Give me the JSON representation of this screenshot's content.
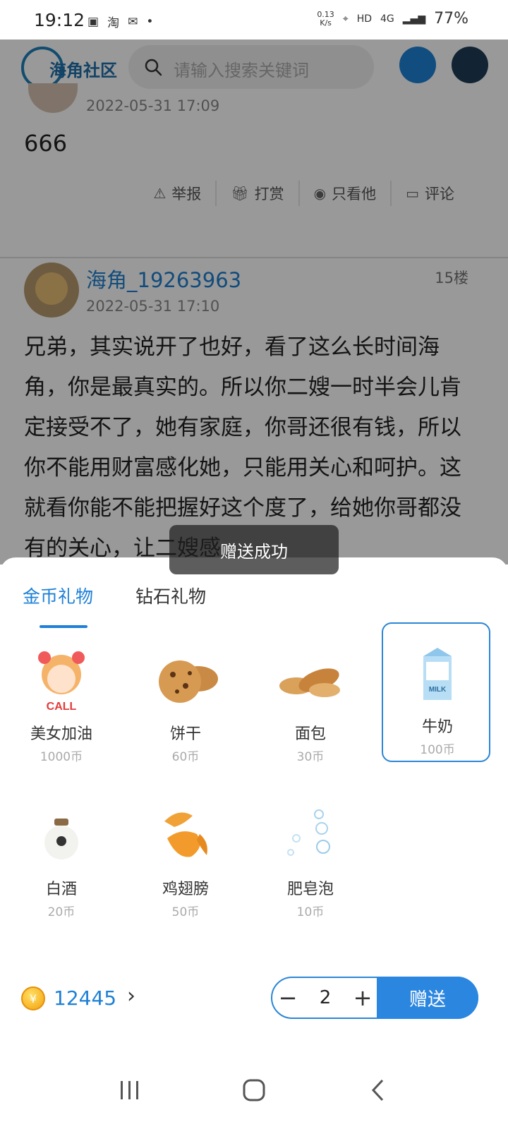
{
  "status_bar": {
    "time": "19:12",
    "net_speed": "0.13",
    "net_unit": "K/s",
    "hd": "HD",
    "signal": "4G",
    "battery": "77%"
  },
  "header": {
    "logo_text": "海角社区",
    "search_placeholder": "请输入搜索关键词"
  },
  "previous_post": {
    "date": "2022-05-31 17:09",
    "content": "666",
    "actions": [
      {
        "label": "举报",
        "icon": "warning-icon"
      },
      {
        "label": "打赏",
        "icon": "gift-icon"
      },
      {
        "label": "只看他",
        "icon": "eye-icon"
      },
      {
        "label": "评论",
        "icon": "comment-icon"
      }
    ]
  },
  "post": {
    "author": "海角_19263963",
    "floor": "15楼",
    "date": "2022-05-31 17:10",
    "body": "兄弟，其实说开了也好，看了这么长时间海角，你是最真实的。所以你二嫂一时半会儿肯定接受不了，她有家庭，你哥还很有钱，所以你不能用财富感化她，只能用关心和呵护。这就看你能不能把握好这个度了，给她你哥都没有的关心，让二嫂感"
  },
  "toast": "赠送成功",
  "gift_sheet": {
    "tabs": [
      {
        "label": "金币礼物",
        "active": true
      },
      {
        "label": "钻石礼物",
        "active": false
      }
    ],
    "gifts": [
      {
        "name": "美女加油",
        "price": "1000币",
        "selected": false
      },
      {
        "name": "饼干",
        "price": "60币",
        "selected": false
      },
      {
        "name": "面包",
        "price": "30币",
        "selected": false
      },
      {
        "name": "牛奶",
        "price": "100币",
        "selected": true
      },
      {
        "name": "白酒",
        "price": "20币",
        "selected": false
      },
      {
        "name": "鸡翅膀",
        "price": "50币",
        "selected": false
      },
      {
        "name": "肥皂泡",
        "price": "10币",
        "selected": false
      }
    ],
    "balance": "12445",
    "quantity": "2",
    "minus": "−",
    "plus": "+",
    "send_label": "赠送",
    "accent": "#2b86e0"
  }
}
